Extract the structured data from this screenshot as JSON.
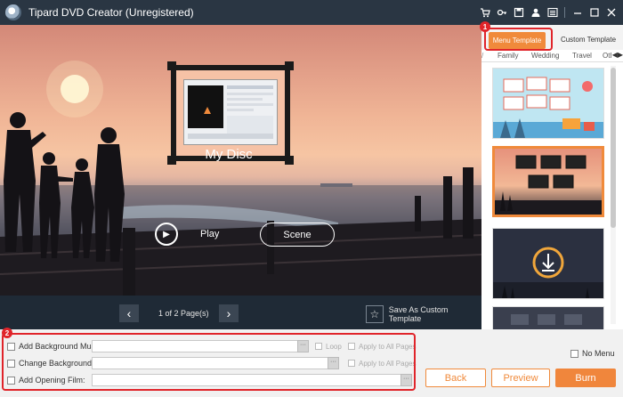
{
  "window": {
    "title": "Tipard DVD Creator (Unregistered)",
    "toolbar_icons": [
      "cart-icon",
      "key-icon",
      "save-icon",
      "user-icon",
      "menu-icon",
      "minimize-icon",
      "maximize-icon",
      "close-icon"
    ]
  },
  "preview": {
    "disc_title": "My Disc",
    "play_label": "Play",
    "scene_label": "Scene"
  },
  "pager": {
    "page_text": "1 of 2 Page(s)",
    "save_custom_label": "Save As Custom Template"
  },
  "templates": {
    "tabs": [
      "Menu Template",
      "Custom Template"
    ],
    "categories": [
      "Family",
      "Wedding",
      "Travel",
      "Oth"
    ],
    "selected_index": 1
  },
  "options": {
    "bg_music_label": "Add Background Music:",
    "change_bg_label": "Change Background:",
    "opening_film_label": "Add Opening Film:",
    "browse_label": "···",
    "loop_label": "Loop",
    "apply_all_label": "Apply to All Pages",
    "no_menu_label": "No Menu"
  },
  "buttons": {
    "back": "Back",
    "preview": "Preview",
    "burn": "Burn"
  },
  "callouts": [
    "1",
    "2"
  ],
  "colors": {
    "accent": "#f08a3b",
    "titlebar": "#2a3643",
    "callout": "#e0242a"
  }
}
